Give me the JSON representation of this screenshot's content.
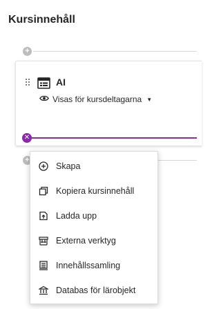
{
  "header": {
    "title": "Kursinnehåll"
  },
  "content_item": {
    "title": "AI",
    "visibility": "Visas för kursdeltagarna"
  },
  "menu": {
    "items": [
      {
        "label": "Skapa",
        "icon": "plus-circle-icon"
      },
      {
        "label": "Kopiera kursinnehåll",
        "icon": "copy-icon"
      },
      {
        "label": "Ladda upp",
        "icon": "upload-icon"
      },
      {
        "label": "Externa verktyg",
        "icon": "external-tools-icon"
      },
      {
        "label": "Innehållssamling",
        "icon": "collection-icon"
      },
      {
        "label": "Databas för lärobjekt",
        "icon": "learning-object-repository-icon"
      }
    ]
  },
  "colors": {
    "accent": "#8b2aa6",
    "text": "#262626",
    "divider": "#d6d6d6"
  }
}
